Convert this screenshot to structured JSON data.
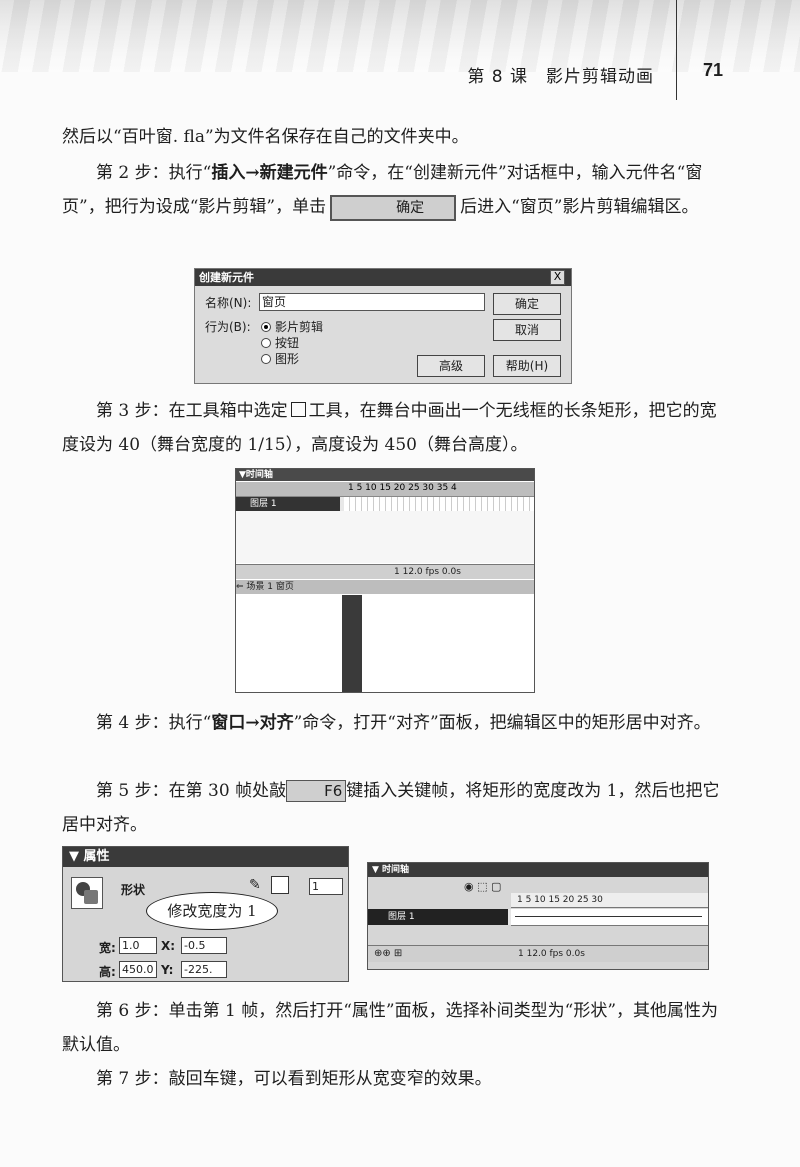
{
  "header": {
    "chapter": "第 8 课　影片剪辑动画",
    "page_number": "71"
  },
  "paragraphs": {
    "p0": "然后以“百叶窗. fla”为文件名保存在自己的文件夹中。",
    "step2_prefix": "第 2 步：执行“",
    "step2_bold": "插入→新建元件",
    "step2_mid": "”命令，在“创建新元件”对话框中，输入元件名“窗页”，把行为设成“影片剪辑”，单击",
    "step2_btn": "确定",
    "step2_suffix": "后进入“窗页”影片剪辑编辑区。",
    "step3_prefix": "第 3 步：在工具箱中选定",
    "step3_suffix": "工具，在舞台中画出一个无线框的长条矩形，把它的宽度设为 40（舞台宽度的 1/15），高度设为 450（舞台高度）。",
    "step4_prefix": "第 4 步：执行“",
    "step4_bold": "窗口→对齐",
    "step4_suffix": "”命令，打开“对齐”面板，把编辑区中的矩形居中对齐。",
    "step5_prefix": "第 5 步：在第 30 帧处敲",
    "step5_key": "F6",
    "step5_suffix": "键插入关键帧，将矩形的宽度改为 1，然后也把它居中对齐。",
    "step6": "第 6 步：单击第 1 帧，然后打开“属性”面板，选择补间类型为“形状”，其他属性为默认值。",
    "step7": "第 7 步：敲回车键，可以看到矩形从宽变窄的效果。"
  },
  "dialog": {
    "title": "创建新元件",
    "close": "X",
    "name_label": "名称(N):",
    "name_value": "窗页",
    "behavior_label": "行为(B):",
    "options": [
      "影片剪辑",
      "按钮",
      "图形"
    ],
    "ok": "确定",
    "cancel": "取消",
    "advanced": "高级",
    "help": "帮助(H)"
  },
  "timeline1": {
    "title": "▼时间轴",
    "ruler": "1    5    10   15   20   25   30   35   4",
    "layer": "图层 1",
    "status": "1   12.0 fps   0.0s",
    "breadcrumb": "⇐  场景 1   窗页"
  },
  "properties": {
    "title": "▼ 属性",
    "shape_label": "形状",
    "width_label": "宽:",
    "width_value": "1.0",
    "height_label": "高:",
    "height_value": "450.0",
    "x_label": "X:",
    "x_value": "-0.5",
    "y_label": "Y:",
    "y_value": "-225.",
    "stroke_value": "1",
    "callout": "修改宽度为 1"
  },
  "timeline2": {
    "title": "▼ 时间轴",
    "ruler": "1     5     10    15    20    25    30",
    "layer": "图层 1",
    "status": "1   12.0 fps   0.0s"
  }
}
